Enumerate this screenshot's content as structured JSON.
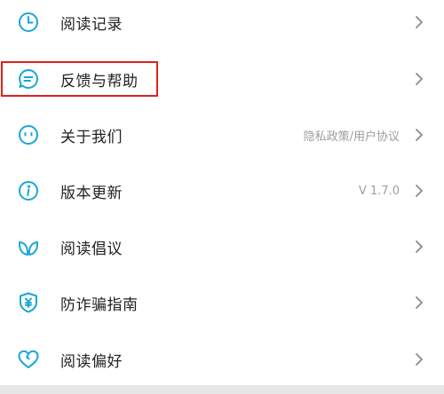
{
  "menu": {
    "items": [
      {
        "label": "阅读记录",
        "value": "",
        "icon": "clock-icon"
      },
      {
        "label": "反馈与帮助",
        "value": "",
        "icon": "feedback-icon"
      },
      {
        "label": "关于我们",
        "value": "隐私政策/用户协议",
        "icon": "smiley-icon"
      },
      {
        "label": "版本更新",
        "value": "V 1.7.0",
        "icon": "info-icon"
      },
      {
        "label": "阅读倡议",
        "value": "",
        "icon": "leaf-icon"
      },
      {
        "label": "防诈骗指南",
        "value": "",
        "icon": "shield-yuan-icon"
      },
      {
        "label": "阅读偏好",
        "value": "",
        "icon": "heart-icon"
      }
    ]
  },
  "colors": {
    "accent": "#1aa6d6",
    "highlight_box": "#e02020",
    "text": "#222222",
    "secondary_text": "#9e9e9e",
    "chevron": "#8a8a8a"
  }
}
